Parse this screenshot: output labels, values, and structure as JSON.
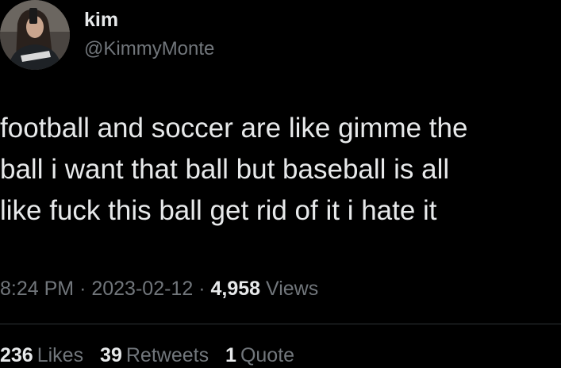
{
  "author": {
    "display_name": "kim",
    "handle": "@KimmyMonte"
  },
  "tweet": {
    "lines": [
      "football and soccer are like gimme the",
      "ball i want that ball but baseball is all",
      "like fuck this ball get rid of it i hate it"
    ]
  },
  "meta": {
    "time": "8:24 PM",
    "separator": "·",
    "date": "2023-02-12",
    "views_count": "4,958",
    "views_label": "Views"
  },
  "stats": {
    "likes_count": "236",
    "likes_label": "Likes",
    "retweets_count": "39",
    "retweets_label": "Retweets",
    "quotes_count": "1",
    "quotes_label": "Quote"
  },
  "colors": {
    "background": "#000000",
    "primary_text": "#e7e9ea",
    "secondary_text": "#71767b",
    "divider": "#2f3336"
  }
}
